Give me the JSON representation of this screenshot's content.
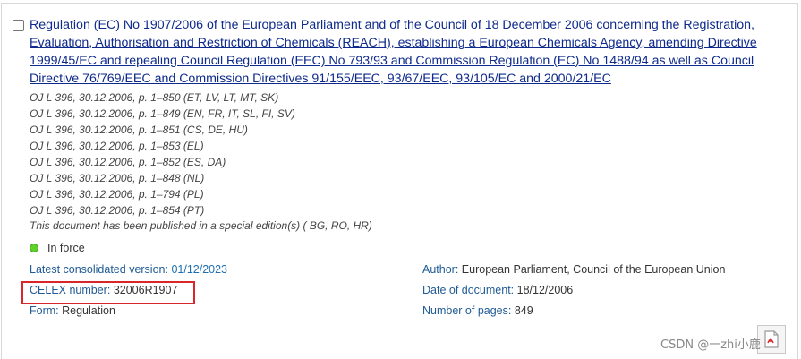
{
  "document": {
    "title": "Regulation (EC) No 1907/2006 of the European Parliament and of the Council of 18 December 2006 concerning the Registration, Evaluation, Authorisation and Restriction of Chemicals (REACH), establishing a European Chemicals Agency, amending Directive 1999/45/EC and repealing Council Regulation (EEC) No 793/93 and Commission Regulation (EC) No 1488/94 as well as Council Directive 76/769/EEC and Commission Directives 91/155/EEC, 93/67/EEC, 93/105/EC and 2000/21/EC",
    "oj_references": [
      "OJ L 396, 30.12.2006, p. 1–850 (ET, LV, LT, MT, SK)",
      "OJ L 396, 30.12.2006, p. 1–849 (EN, FR, IT, SL, FI, SV)",
      "OJ L 396, 30.12.2006, p. 1–851 (CS, DE, HU)",
      "OJ L 396, 30.12.2006, p. 1–853 (EL)",
      "OJ L 396, 30.12.2006, p. 1–852 (ES, DA)",
      "OJ L 396, 30.12.2006, p. 1–848 (NL)",
      "OJ L 396, 30.12.2006, p. 1–794 (PL)",
      "OJ L 396, 30.12.2006, p. 1–854 (PT)"
    ],
    "special_edition_note": "This document has been published in a special edition(s) ( BG, RO, HR)",
    "status": "In force",
    "status_color": "#5fd12a"
  },
  "meta": {
    "consolidated_label": "Latest consolidated version:",
    "consolidated_value": "01/12/2023",
    "celex_label": "CELEX number:",
    "celex_value": "32006R1907",
    "form_label": "Form:",
    "form_value": "Regulation",
    "author_label": "Author:",
    "author_value": "European Parliament, Council of the European Union",
    "date_label": "Date of document:",
    "date_value": "18/12/2006",
    "pages_label": "Number of pages:",
    "pages_value": "849"
  },
  "watermark": "CSDN @一zhi小鹿",
  "colors": {
    "title_link": "#0e2a8c",
    "meta_label": "#1f5b95",
    "highlight_border": "#d9262a"
  }
}
